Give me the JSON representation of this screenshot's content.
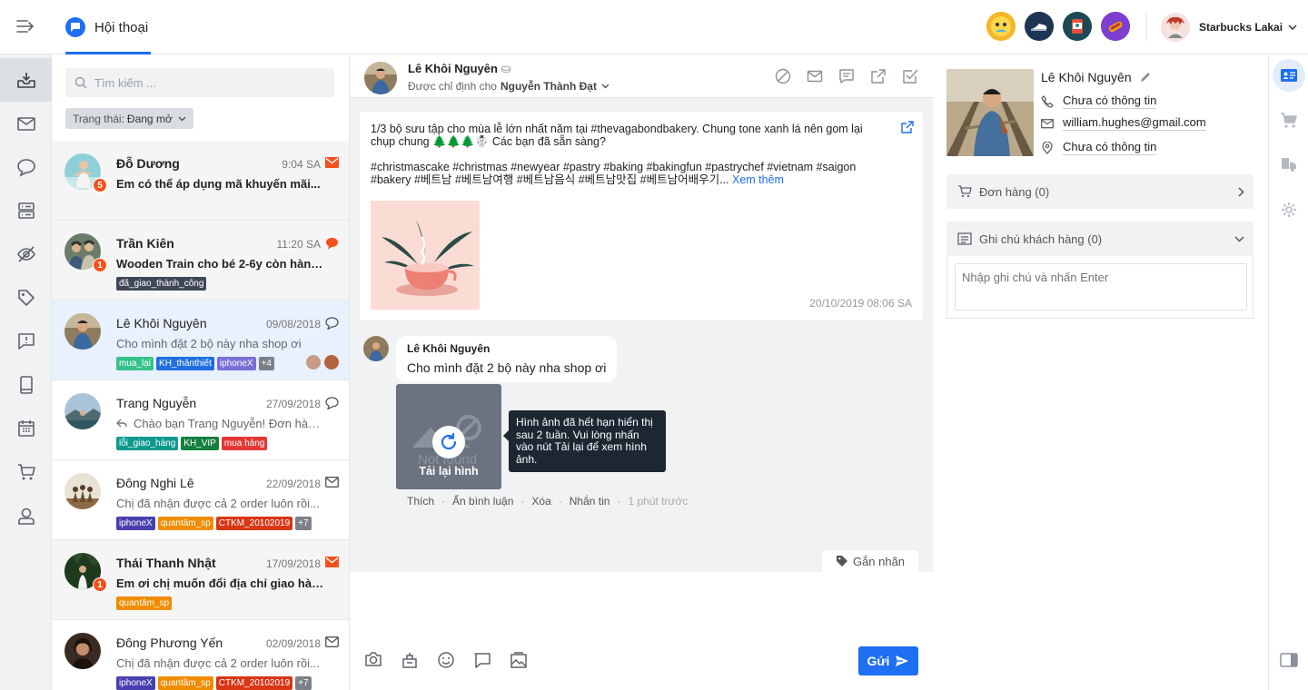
{
  "header": {
    "title": "Hội thoại",
    "account_name": "Starbucks Lakai",
    "pages": [
      "page-icon-1",
      "page-icon-2",
      "page-icon-3",
      "page-icon-4"
    ]
  },
  "nav_icons": [
    "inbox-icon",
    "mail-icon",
    "chat-icon",
    "server-icon",
    "eye-off-icon",
    "tag-icon",
    "feedback-icon",
    "mobile-icon",
    "calendar-icon",
    "cart-icon",
    "user-icon"
  ],
  "search": {
    "placeholder": "Tìm kiếm ..."
  },
  "filter": {
    "label": "Trạng thái:",
    "value": "Đang mở"
  },
  "conversations": [
    {
      "name": "Đỗ Dương",
      "time": "9:04 SA",
      "message": "Em có thể áp dụng mã khuyến mãi...",
      "badge": "5",
      "channel": "mail",
      "unread": true,
      "tags": []
    },
    {
      "name": "Trần Kiên",
      "time": "11:20 SA",
      "message": "Wooden Train cho bé 2-6y còn hàng...",
      "badge": "1",
      "channel": "comment",
      "unread": true,
      "tags": [
        "đã_giao_thành_công"
      ]
    },
    {
      "name": "Lê Khôi Nguyên",
      "time": "09/08/2018",
      "message": "Cho mình đặt 2 bộ này nha shop ơi",
      "channel": "comment",
      "unread": false,
      "tags": [
        "mua_lại",
        "KH_thânthiết",
        "iphoneX",
        "+4"
      ]
    },
    {
      "name": "Trang Nguyễn",
      "time": "27/09/2018",
      "message": "Chào bạn Trang Nguyễn! Đơn hàng...",
      "channel": "comment",
      "unread": false,
      "tags": [
        "lỗi_giao_hàng",
        "KH_VIP",
        "mua hàng"
      ]
    },
    {
      "name": "Đông Nghi Lê",
      "time": "22/09/2018",
      "message": "Chị đã nhận được cả 2 order luôn rồi...",
      "channel": "mail",
      "unread": false,
      "tags": [
        "iphoneX",
        "quantâm_sp",
        "CTKM_20102019",
        "+7"
      ]
    },
    {
      "name": "Thái Thanh Nhật",
      "time": "17/09/2018",
      "message": "Em ơi chị muốn đổi địa chỉ giao hàng...",
      "badge": "1",
      "channel": "mail",
      "unread": true,
      "tags": [
        "quantâm_sp"
      ]
    },
    {
      "name": "Đông Phương Yến",
      "time": "02/09/2018",
      "message": "Chị đã nhận được cả 2 order luôn rồi...",
      "channel": "mail",
      "unread": false,
      "tags": [
        "iphoneX",
        "quantâm_sp",
        "CTKM_20102019",
        "+7"
      ]
    }
  ],
  "chat": {
    "name": "Lê Khôi Nguyên",
    "assigned_label": "Được chỉ định cho",
    "assigned_to": "Nguyễn Thành Đạt",
    "post_text": "1/3 bộ sưu tập cho mùa lễ lớn nhất năm tại #thevagabondbakery. Chung tone xanh lá nên gom lại chụp chung 🌲🌲🌲☃️ Các bạn đã sẵn sàng?",
    "post_tags": "#christmascake #christmas #newyear #pastry #baking #bakingfun #pastrychef #vietnam #saigon #bakery #베트남 #베트남여행 #베트남음식 #베트남맛집 #베트남어배우기...",
    "see_more": "Xem thêm",
    "post_time": "20/10/2019 08:06 SA",
    "comment_author": "Lê Khôi Nguyên",
    "comment_text": "Cho mình đặt 2 bộ này nha shop ơi",
    "reload_label": "Tải lại hình",
    "tooltip": "Hình ảnh đã hết hạn hiển thị sau 2 tuần. Vui lòng nhấn vào nút Tải lại để xem hình ảnh.",
    "actions": {
      "like": "Thích",
      "hide": "Ẩn bình luận",
      "delete": "Xóa",
      "message": "Nhắn tin",
      "ago": "1 phút trước"
    },
    "label_button": "Gắn nhãn",
    "send_label": "Gửi"
  },
  "profile": {
    "name": "Lê Khôi Nguyên",
    "phone": "Chưa có thông tin",
    "email": "william.hughes@gmail.com",
    "address": "Chưa có thông tin",
    "orders_label": "Đơn hàng (0)",
    "notes_label": "Ghi chú khách hàng (0)",
    "note_placeholder": "Nhập ghi chú và nhấn Enter"
  },
  "colors": {
    "accent": "#1e6ff1",
    "badge": "#f4511e",
    "nav_bg": "#f1f2f4"
  }
}
